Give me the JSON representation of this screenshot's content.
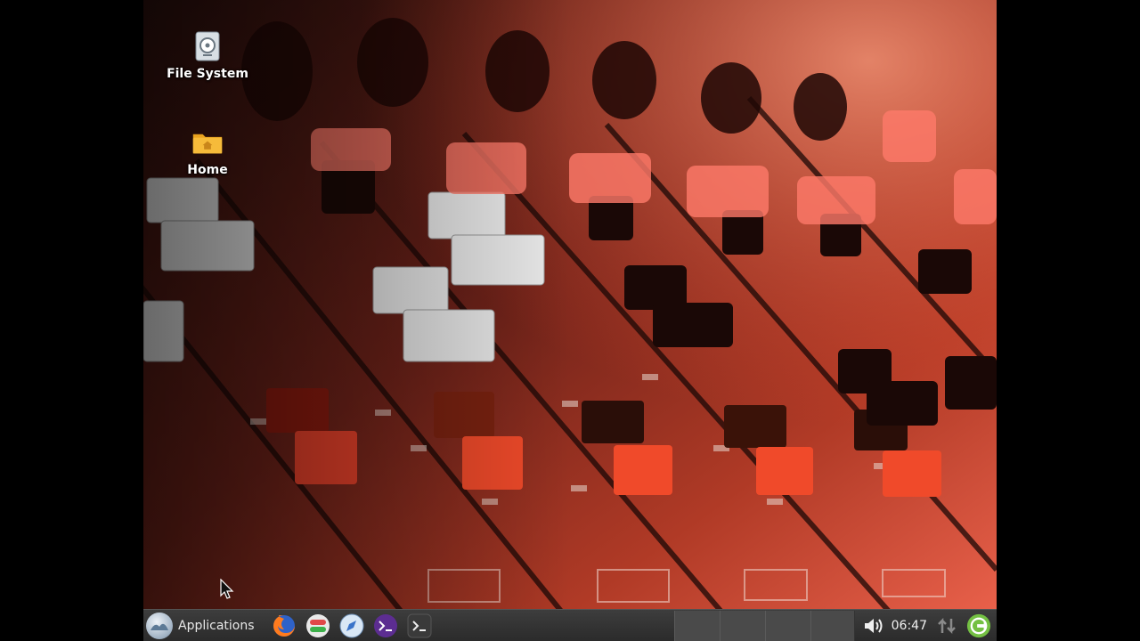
{
  "desktop": {
    "icons": [
      {
        "label": "File System",
        "icon": "drive-icon"
      },
      {
        "label": "Home",
        "icon": "home-folder-icon"
      }
    ]
  },
  "panel": {
    "menu_label": "Applications",
    "launchers": [
      "firefox-icon",
      "toggle-app-icon",
      "compass-icon",
      "terminal-purple-icon",
      "terminal-icon"
    ],
    "clock": "06:47"
  },
  "colors": {
    "panel_bg": "#333333",
    "folder": "#f2b230",
    "power": "#74c043",
    "terminal_purple": "#5c2d91"
  }
}
